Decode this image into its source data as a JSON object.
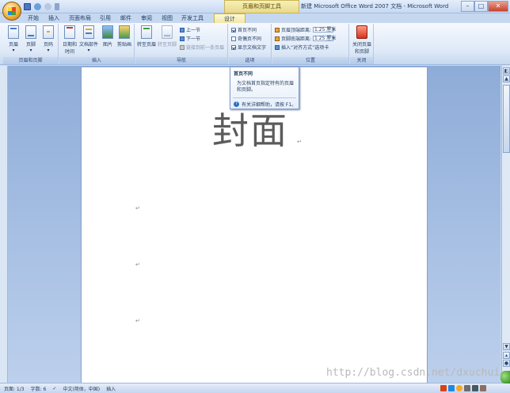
{
  "titlebar": {
    "contextual_tab": "页眉和页脚工具",
    "title": "新建 Microsoft Office Word 2007 文档 - Microsoft Word",
    "minimize": "–",
    "maximize": "□",
    "close": "✕"
  },
  "tabs": [
    "开始",
    "插入",
    "页面布局",
    "引用",
    "邮件",
    "审阅",
    "视图",
    "开发工具",
    "设计"
  ],
  "ribbon": {
    "group_header_footer": {
      "label": "页眉和页脚",
      "header": "页眉",
      "footer": "页脚",
      "page_number": "页码"
    },
    "group_insert": {
      "label": "插入",
      "datetime": "日期和\n时间",
      "doc_parts": "文档部件",
      "picture": "图片",
      "clipart": "剪贴画"
    },
    "group_navigation": {
      "label": "导航",
      "goto_header": "转至页眉",
      "goto_footer": "转至页脚",
      "prev": "上一节",
      "next": "下一节",
      "link_prev": "链接到前一条页眉"
    },
    "group_options": {
      "label": "选项",
      "first_page": "首页不同",
      "odd_even": "奇偶页不同",
      "show_text": "显示文档文字"
    },
    "group_position": {
      "label": "位置",
      "header_dist_label": "页眉顶端距离:",
      "header_dist_value": "1.25 厘米",
      "footer_dist_label": "页脚底端距离:",
      "footer_dist_value": "1.25 厘米",
      "align_tab": "插入“对齐方式”选项卡"
    },
    "group_close": {
      "label": "关闭",
      "close_btn": "关闭页眉\n和页脚"
    }
  },
  "tooltip": {
    "title": "首页不同",
    "body": "为文档首页指定特有的页眉和页脚。",
    "help": "有关详细帮助，请按 F1。"
  },
  "document": {
    "cover_text": "封面",
    "para_mark": "↵"
  },
  "status": {
    "page": "页面: 1/3",
    "words": "字数: 6",
    "language": "中文(简体，中国)",
    "mode": "插入"
  },
  "watermark": "http://blog.csdn.net/dxuchui",
  "colors": {
    "ribbon_bg": "#dde8f7",
    "contextual_tab": "#e8d98c",
    "doc_bg": "#8eacd8",
    "close_red": "#d6331c"
  }
}
